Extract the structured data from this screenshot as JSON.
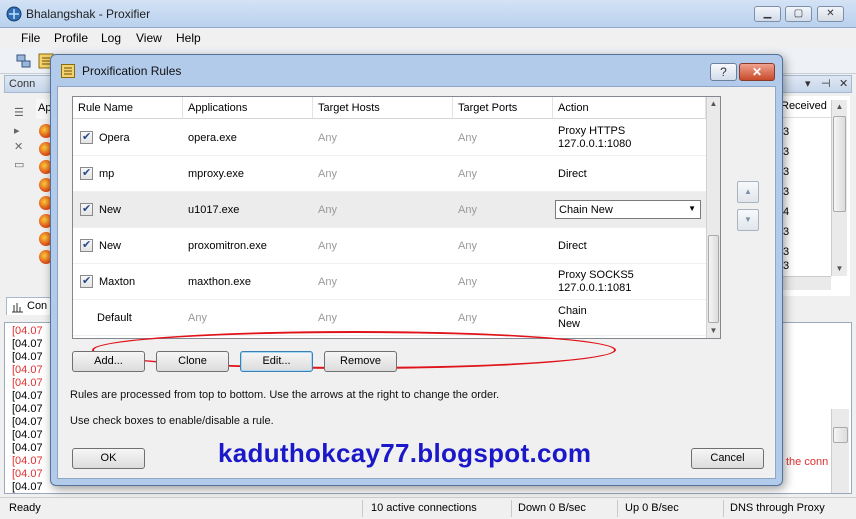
{
  "app": {
    "title": "Bhalangshak - Proxifier",
    "menu": [
      "File",
      "Profile",
      "Log",
      "View",
      "Help"
    ],
    "panel_label": "Conn",
    "connections_tab": "Con",
    "apps_column_stub": "Ap",
    "received_header": "Received",
    "received_digits": [
      "3",
      "3",
      "3",
      "3",
      "4",
      "3",
      "3",
      "3"
    ],
    "log_lines": [
      {
        "text": "[04.07",
        "color": "red"
      },
      {
        "text": "[04.07",
        "color": "black"
      },
      {
        "text": "[04.07",
        "color": "black"
      },
      {
        "text": "[04.07",
        "color": "red"
      },
      {
        "text": "[04.07",
        "color": "red"
      },
      {
        "text": "[04.07",
        "color": "black"
      },
      {
        "text": "[04.07",
        "color": "black"
      },
      {
        "text": "[04.07",
        "color": "black"
      },
      {
        "text": "[04.07",
        "color": "black"
      },
      {
        "text": "[04.07",
        "color": "black"
      },
      {
        "text": "[04.07",
        "color": "red"
      },
      {
        "text": "[04.07",
        "color": "red"
      },
      {
        "text": "[04.07",
        "color": "black"
      }
    ],
    "log_right_text": "the conn",
    "status": {
      "ready": "Ready",
      "connections": "10 active connections",
      "down": "Down 0 B/sec",
      "up": "Up 0 B/sec",
      "dns": "DNS through Proxy"
    }
  },
  "dialog": {
    "title": "Proxification Rules",
    "help": "?",
    "close": "✕",
    "columns": [
      "Rule Name",
      "Applications",
      "Target Hosts",
      "Target Ports",
      "Action"
    ],
    "rules": [
      {
        "checked": true,
        "name": "Opera",
        "app": "opera.exe",
        "hosts": "Any",
        "ports": "Any",
        "action_lines": [
          "Proxy HTTPS",
          "127.0.0.1:1080"
        ],
        "dropdown": false
      },
      {
        "checked": true,
        "name": "mp",
        "app": "mproxy.exe",
        "hosts": "Any",
        "ports": "Any",
        "action_lines": [
          "Direct"
        ],
        "dropdown": false
      },
      {
        "checked": true,
        "name": "New",
        "app": "u1017.exe",
        "hosts": "Any",
        "ports": "Any",
        "action_lines": [
          "Chain New"
        ],
        "dropdown": true
      },
      {
        "checked": true,
        "name": "New",
        "app": "proxomitron.exe",
        "hosts": "Any",
        "ports": "Any",
        "action_lines": [
          "Direct"
        ],
        "dropdown": false
      },
      {
        "checked": true,
        "name": "Maxton",
        "app": "maxthon.exe",
        "hosts": "Any",
        "ports": "Any",
        "action_lines": [
          "Proxy SOCKS5",
          "127.0.0.1:1081"
        ],
        "dropdown": false
      },
      {
        "checked": false,
        "name": "Default",
        "app": "Any",
        "hosts": "Any",
        "ports": "Any",
        "action_lines": [
          "Chain",
          "New"
        ],
        "dropdown": false
      }
    ],
    "buttons": {
      "add": "Add...",
      "clone": "Clone",
      "edit": "Edit...",
      "remove": "Remove",
      "ok": "OK",
      "cancel": "Cancel"
    },
    "note1": "Rules are processed from top to bottom. Use the arrows at the right to change the order.",
    "note2": "Use check boxes to enable/disable a rule.",
    "watermark": "kaduthokcay77.blogspot.com"
  }
}
